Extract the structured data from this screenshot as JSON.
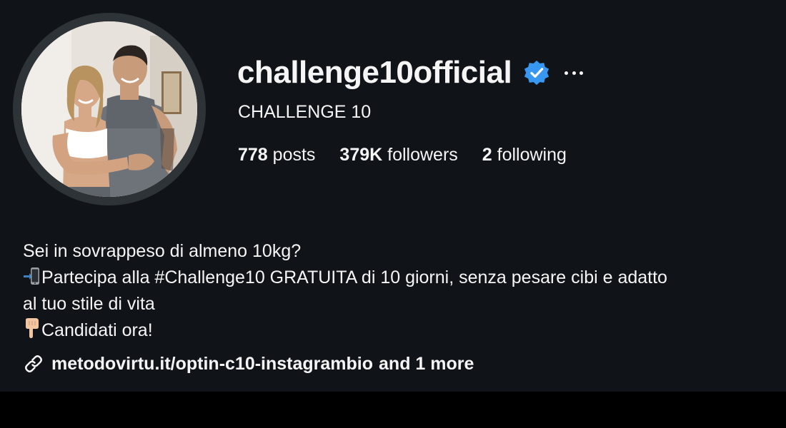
{
  "profile": {
    "username": "challenge10official",
    "full_name": "CHALLENGE 10",
    "verified_icon": "verified-badge-icon",
    "more_icon": "more-options-icon",
    "avatar_icon": "profile-photo"
  },
  "stats": {
    "posts_count": "778",
    "posts_label": " posts",
    "followers_count": "379K",
    "followers_label": " followers",
    "following_count": "2",
    "following_label": " following"
  },
  "bio": {
    "line1": "Sei in sovrappeso di almeno 10kg?",
    "line2_emoji": "mobile-phone-arrow-icon",
    "line2": "Partecipa alla #Challenge10 GRATUITA di 10 giorni, senza pesare cibi e adatto",
    "line3": "al tuo stile di vita",
    "line4_emoji": "pointing-down-hand-icon",
    "line4": "Candidati ora!"
  },
  "links": {
    "icon": "link-icon",
    "url_text": "metodovirtu.it/optin-c10-instagrambio",
    "more_text": "and 1 more"
  },
  "colors": {
    "panel_background": "#101418",
    "page_background": "#000000",
    "text": "#f5f5f5",
    "verified_blue": "#3897f0",
    "avatar_ring": "#2e3338"
  }
}
